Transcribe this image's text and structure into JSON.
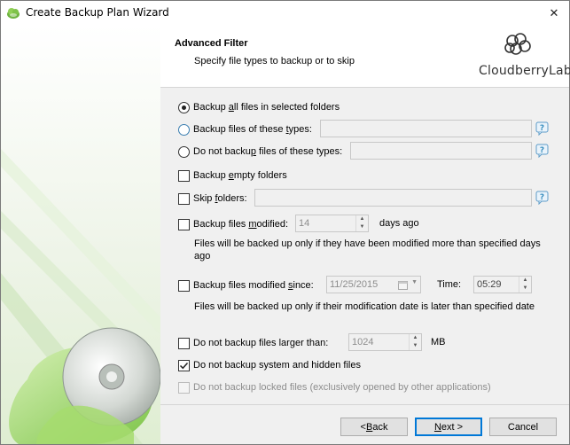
{
  "window": {
    "title": "Create Backup Plan Wizard",
    "close_glyph": "✕"
  },
  "header": {
    "title": "Advanced Filter",
    "subtitle": "Specify file types to backup or to skip",
    "logo_text": "CloudberryLab"
  },
  "options": {
    "backup_all": {
      "pre": "Backup ",
      "u": "a",
      "post": "ll files in selected folders",
      "checked": true
    },
    "backup_types": {
      "pre": "Backup files of these ",
      "u": "t",
      "post": "ypes:",
      "value": ""
    },
    "skip_types": {
      "pre": "Do not backu",
      "u": "p",
      "post": " files of these types:",
      "value": ""
    },
    "empty_folders": {
      "pre": "Backup ",
      "u": "e",
      "post": "mpty folders",
      "checked": false
    },
    "skip_folders": {
      "pre": "Skip ",
      "u": "f",
      "post": "olders:",
      "checked": false,
      "value": ""
    },
    "modified": {
      "pre": "Backup files ",
      "u": "m",
      "post": "odified:",
      "checked": false,
      "value": "14",
      "unit": "days ago",
      "note": "Files will be backed up only if they have been modified more than specified days ago"
    },
    "modified_since": {
      "pre": "Backup files modified ",
      "u": "s",
      "post": "ince:",
      "checked": false,
      "date": "11/25/2015",
      "time_label": "Time:",
      "time": "05:29",
      "note": "Files will be backed up only if their modification date is later than specified date"
    },
    "larger_than": {
      "label": "Do not backup files larger than:",
      "checked": false,
      "value": "1024",
      "unit": "MB"
    },
    "system_hidden": {
      "label": "Do not backup system and hidden files",
      "checked": true
    },
    "locked": {
      "label": "Do not backup locked files (exclusively opened by other applications)",
      "checked": false,
      "disabled": true
    }
  },
  "footer": {
    "back": {
      "pre": "< ",
      "u": "B",
      "post": "ack"
    },
    "next": {
      "pre": "",
      "u": "N",
      "post": "ext >"
    },
    "cancel": "Cancel"
  },
  "colors": {
    "accent": "#0078d7",
    "help_icon": "#3c8fbf",
    "brand_green": "#7bbf3d"
  },
  "icons": [
    "app-cloud-icon",
    "close-icon",
    "cloudberry-logo-icon",
    "help-icon",
    "spin-up-icon",
    "spin-down-icon",
    "calendar-icon",
    "checkmark-icon",
    "disc-icon"
  ]
}
